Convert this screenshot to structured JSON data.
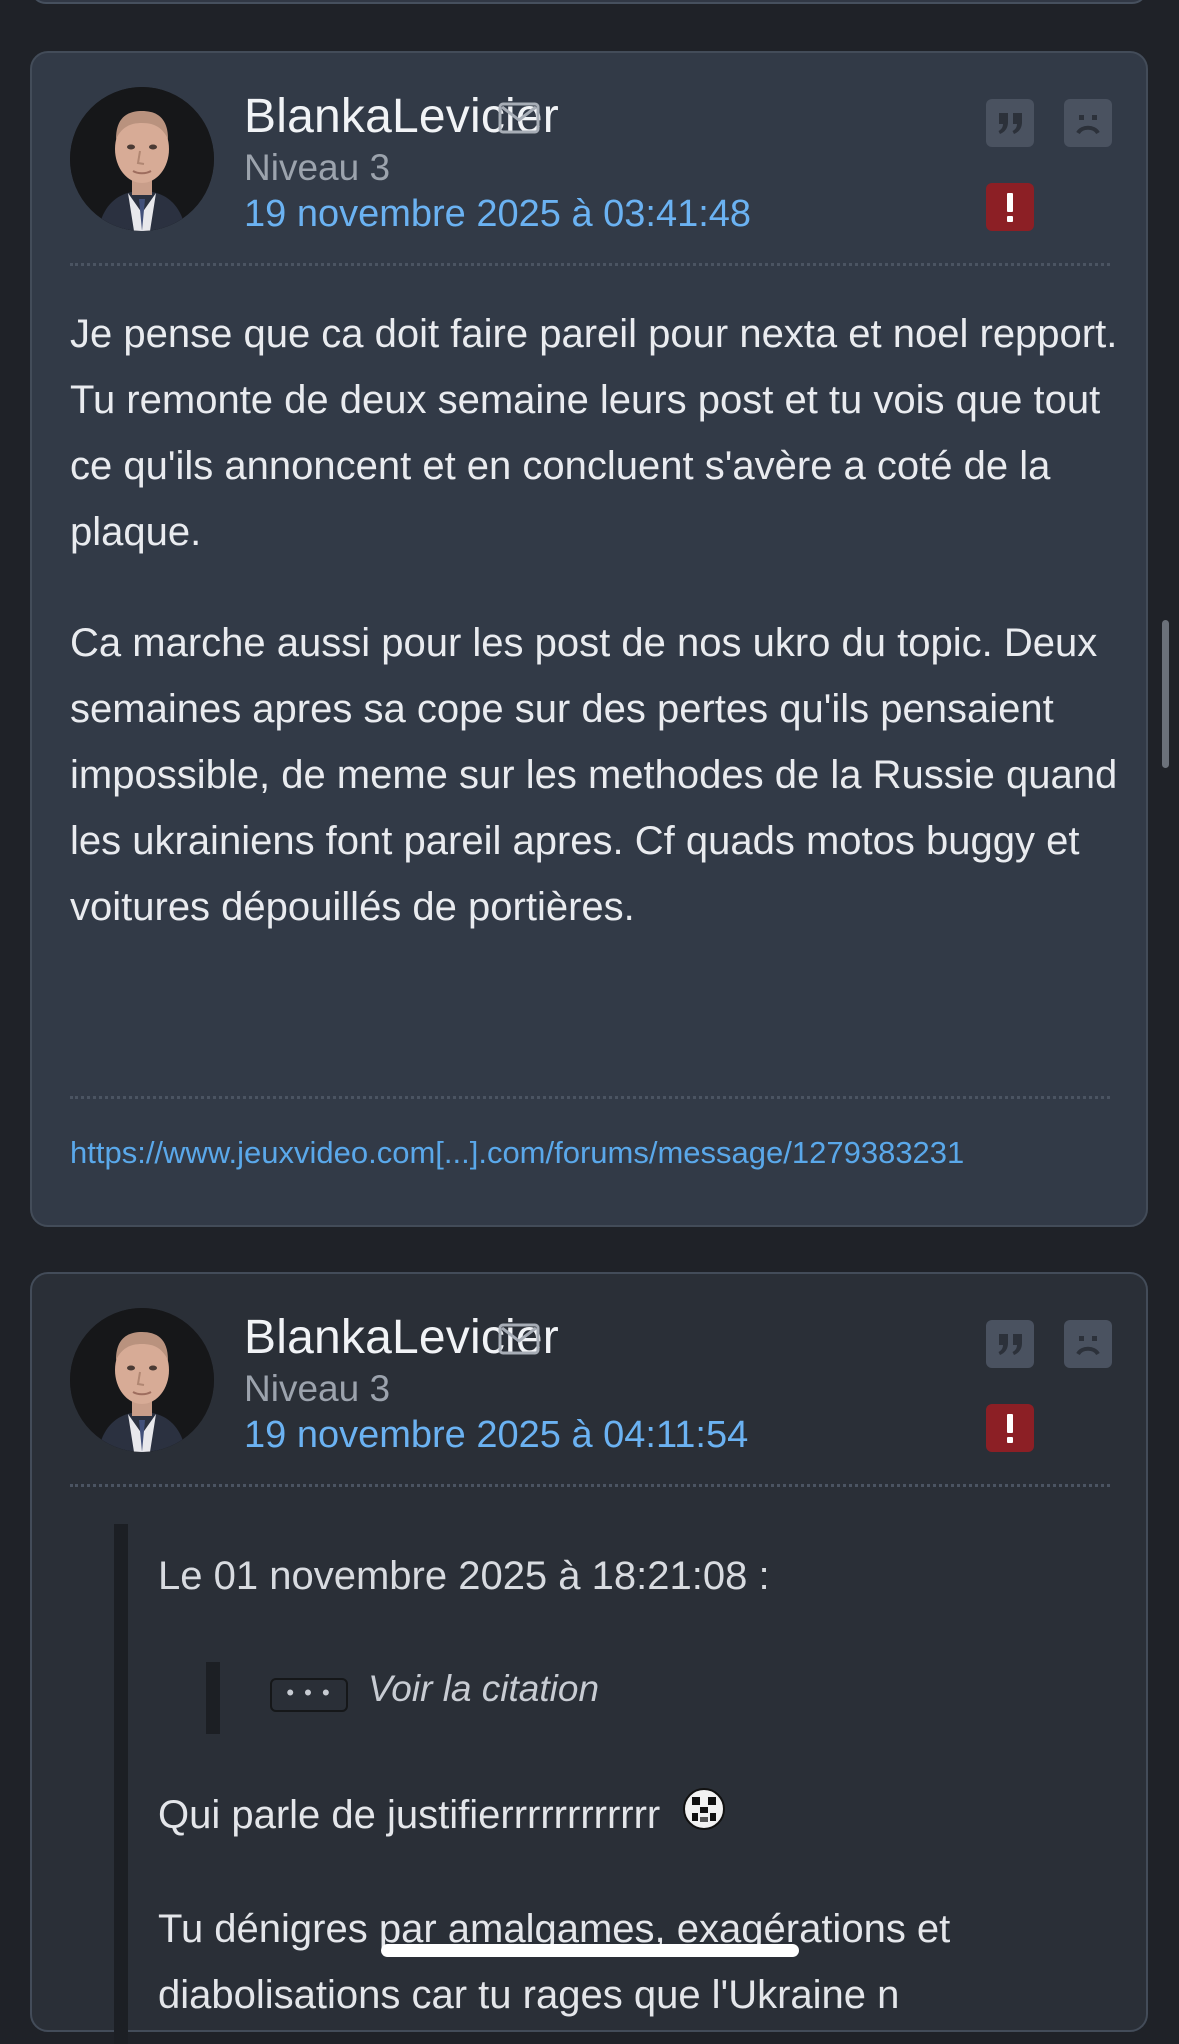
{
  "posts": [
    {
      "author": "BlankaLevicier",
      "level": "Niveau 3",
      "date": "19 novembre 2025 à 03:41:48",
      "paragraphs": [
        "Je pense que ca doit faire pareil pour nexta et noel repport. Tu remonte de deux semaine leurs post et tu vois que tout ce qu'ils annoncent et en concluent s'avère a coté de la plaque.",
        "Ca marche aussi pour les post de nos ukro du topic. Deux semaines apres sa cope sur des pertes qu'ils pensaient impossible, de meme sur les methodes de la Russie quand les ukrainiens font pareil apres. Cf quads motos buggy et voitures dépouillés de portières."
      ],
      "link": "https://www.jeuxvideo.com[...].com/forums/message/1279383231"
    },
    {
      "author": "BlankaLevicier",
      "level": "Niveau 3",
      "date": "19 novembre 2025 à 04:11:54",
      "quote": {
        "header": "Le 01 novembre 2025 à 18:21:08 :",
        "ellipsis": "• • •",
        "see_quote": "Voir la citation",
        "reply_line": "Qui parle de justifierrrrrrrrrrrr",
        "next_line": "Tu dénigres par amalgames, exagérations et diabolisations car tu rages que l'Ukraine n"
      }
    }
  ],
  "icons": {
    "mail": "envelope-icon",
    "quote": "quote-icon",
    "sad": "sad-face-icon",
    "report": "exclamation-icon",
    "smiley": "noel-smiley-icon"
  },
  "colors": {
    "background": "#1f2228",
    "card_primary": "#323a47",
    "card_secondary": "#2a2f37",
    "date_blue": "#6bb2f2",
    "report_red": "#8c1f25"
  }
}
